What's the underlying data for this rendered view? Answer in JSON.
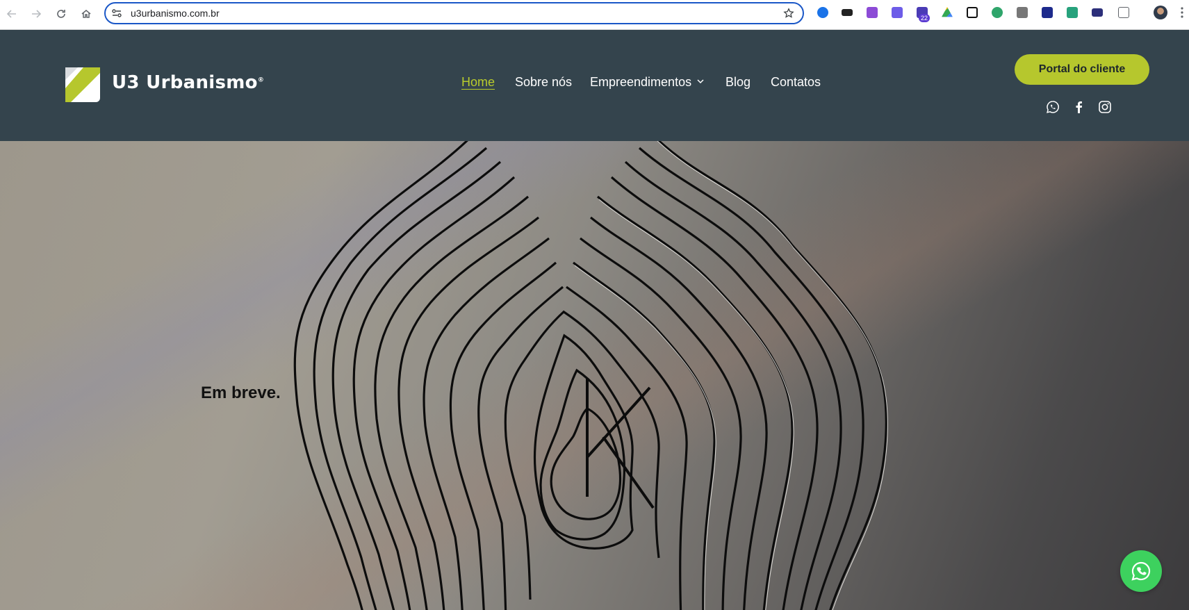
{
  "browser": {
    "url": "u3urbanismo.com.br",
    "extension_badge": "22"
  },
  "site": {
    "logo_text": "U3 Urbanismo",
    "logo_reg": "®",
    "menu": [
      {
        "label": "Home",
        "active": true
      },
      {
        "label": "Sobre nós",
        "active": false
      },
      {
        "label": "Empreendimentos",
        "active": false
      },
      {
        "label": "Blog",
        "active": false
      },
      {
        "label": "Contatos",
        "active": false
      }
    ],
    "portal_button": "Portal do cliente",
    "social": [
      "whatsapp-icon",
      "facebook-icon",
      "instagram-icon"
    ],
    "accent_color": "#b6c72d",
    "header_color": "#34444d"
  },
  "hero": {
    "text": "Em breve."
  }
}
